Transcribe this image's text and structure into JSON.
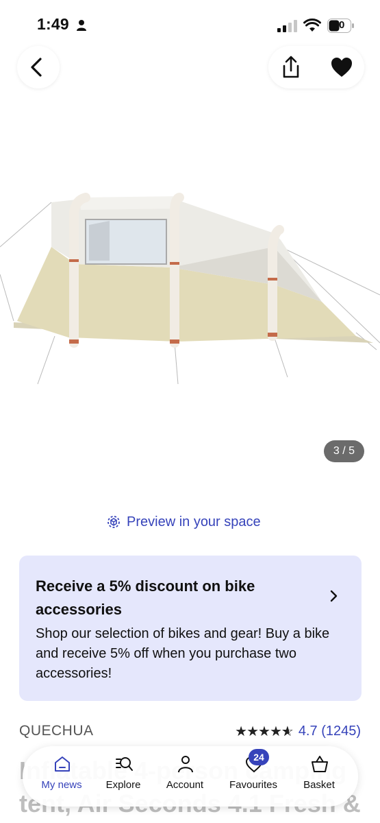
{
  "status_bar": {
    "time": "1:49",
    "battery": "40"
  },
  "gallery": {
    "counter": "3 / 5"
  },
  "preview": {
    "label": "Preview in your space"
  },
  "promo": {
    "title": "Receive a 5% discount on bike accessories",
    "body": "Shop our selection of bikes and gear! Buy a bike and receive 5% off when you purchase two accessories!"
  },
  "product": {
    "brand": "QUECHUA",
    "rating": "4.7",
    "reviews": "(1245)",
    "title": "Inflatable 4-person camping tent, Air Seconds 4.1 Fresh &"
  },
  "nav": {
    "items": [
      {
        "label": "My news",
        "icon": "home-icon"
      },
      {
        "label": "Explore",
        "icon": "explore-icon"
      },
      {
        "label": "Account",
        "icon": "account-icon"
      },
      {
        "label": "Favourites",
        "icon": "heart-outline-icon",
        "badge": "24"
      },
      {
        "label": "Basket",
        "icon": "basket-icon"
      }
    ]
  },
  "colors": {
    "accent": "#3643ba",
    "promo_bg": "#e5e7fc"
  }
}
